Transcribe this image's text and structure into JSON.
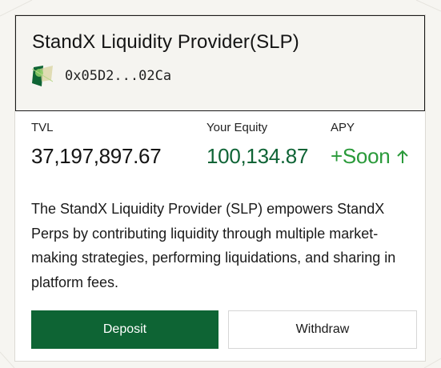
{
  "header": {
    "title": "StandX Liquidity Provider(SLP)",
    "address": "0x05D2...02Ca",
    "logo_icon": "slp-logo-icon"
  },
  "stats": {
    "tvl": {
      "label": "TVL",
      "value": "37,197,897.67"
    },
    "equity": {
      "label": "Your Equity",
      "value": "100,134.87"
    },
    "apy": {
      "label": "APY",
      "value": "+Soon",
      "icon": "arrow-up-icon"
    }
  },
  "description": "The StandX Liquidity Provider (SLP) empowers StandX Perps by contributing liquidity through multiple market-making strategies, performing liquidations, and sharing in platform fees.",
  "actions": {
    "deposit_label": "Deposit",
    "withdraw_label": "Withdraw"
  },
  "colors": {
    "brand_green": "#0e6434",
    "equity_green": "#0f6436",
    "apy_green": "#2a9a3a",
    "header_bg": "#f5f4f0"
  }
}
